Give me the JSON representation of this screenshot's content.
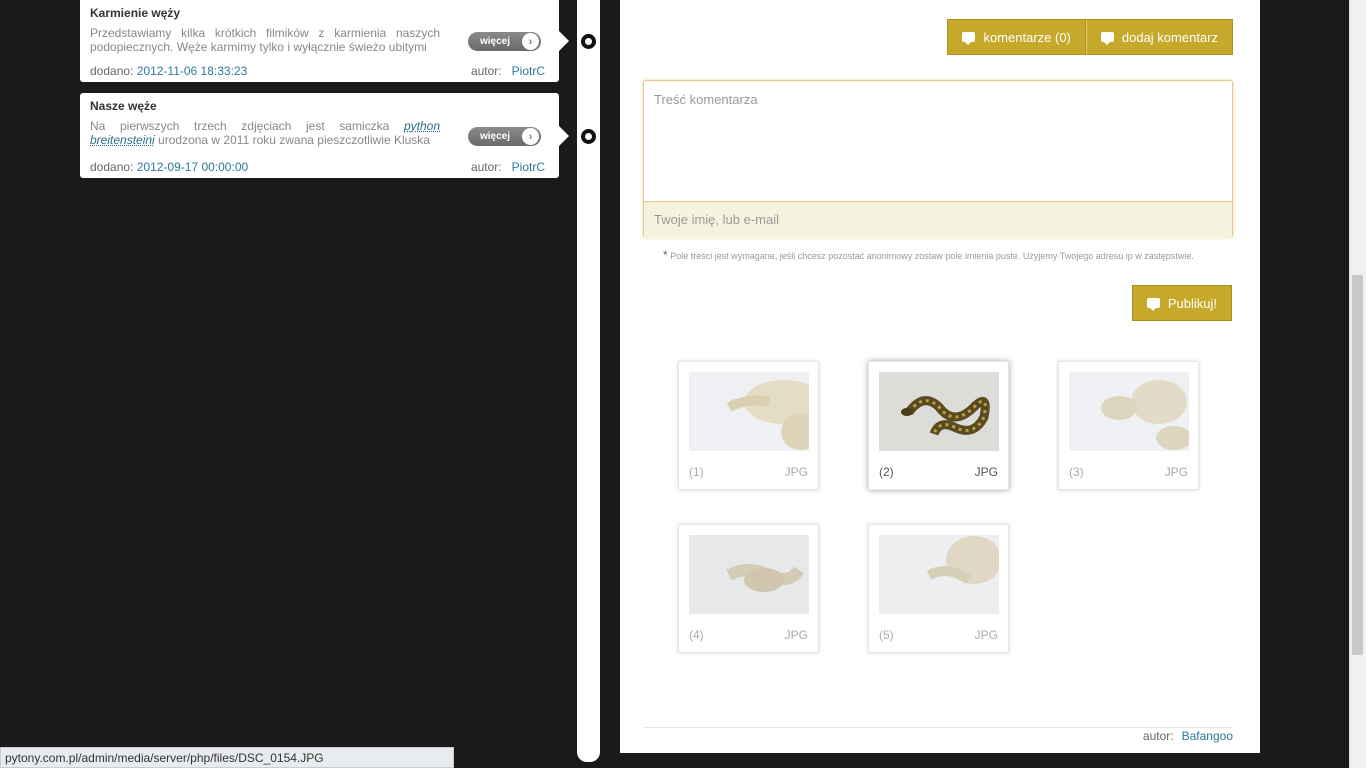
{
  "posts": [
    {
      "title": "Karmienie węży",
      "desc_html_parts": [
        "Przedstawiamy kilka krótkich filmików z karmienia naszych podopiecznych. Węże karmimy tylko i wyłącznie świeżo ubitymi"
      ],
      "added_label": "dodano:",
      "added": "2012-11-06 18:33:23",
      "author_label": "autor:",
      "author": "PiotrC",
      "more": "więcej"
    },
    {
      "title": "Nasze węże",
      "desc_pre": "Na pierwszych trzech zdjęciach jest samiczka",
      "desc_italic": "python breitensteini",
      "desc_post": "urodzona w 2011 roku zwana pieszczotliwie Kluska",
      "added_label": "dodano:",
      "added": "2012-09-17 00:00:00",
      "author_label": "autor:",
      "author": "PiotrC",
      "more": "więcej"
    }
  ],
  "comments": {
    "count_button": "komentarze (0)",
    "add_button": "dodaj komentarz",
    "text_placeholder": "Treść komentarza",
    "name_placeholder": "Twoje imię, lub e-mail",
    "note_star": "*",
    "note": "Pole treści jest wymagane, jeśli chcesz pozostać anonimowy zostaw pole imienia puste. Użyjemy Twojego adresu ip w zastępstwie.",
    "publish": "Publikuj!"
  },
  "gallery": [
    {
      "index": "(1)",
      "ext": "JPG",
      "active": false
    },
    {
      "index": "(2)",
      "ext": "JPG",
      "active": true
    },
    {
      "index": "(3)",
      "ext": "JPG",
      "active": false
    },
    {
      "index": "(4)",
      "ext": "JPG",
      "active": false
    },
    {
      "index": "(5)",
      "ext": "JPG",
      "active": false
    }
  ],
  "footer": {
    "author_label": "autor:",
    "author": "Bafangoo"
  },
  "status_url": "pytony.com.pl/admin/media/server/php/files/DSC_0154.JPG",
  "colors": {
    "accent_gold": "#c6a82a",
    "link_blue": "#2a7a9a",
    "background": "#1a1a1a"
  }
}
